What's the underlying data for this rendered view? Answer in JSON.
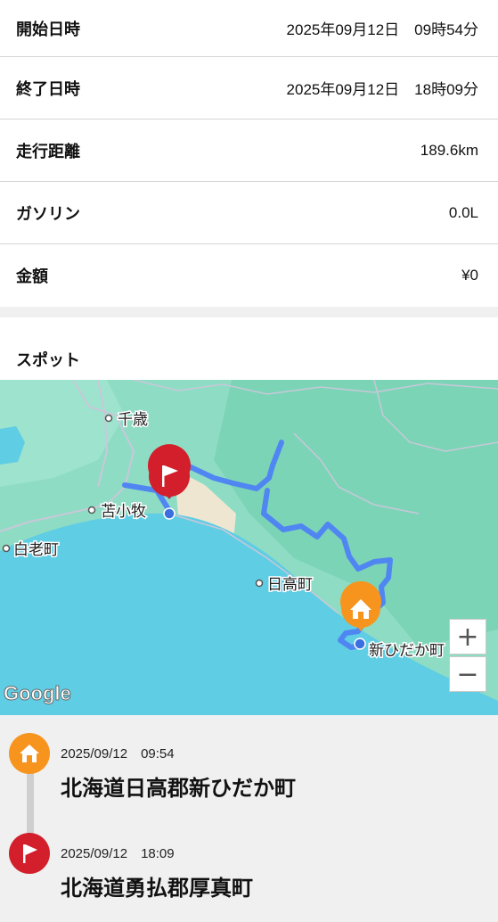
{
  "details": [
    {
      "label": "開始日時",
      "value": "2025年09月12日　09時54分"
    },
    {
      "label": "終了日時",
      "value": "2025年09月12日　18時09分"
    },
    {
      "label": "走行距離",
      "value": "189.6km"
    },
    {
      "label": "ガソリン",
      "value": "0.0L"
    },
    {
      "label": "金額",
      "value": "¥0"
    }
  ],
  "spots": {
    "title": "スポット",
    "map": {
      "labels": {
        "chitose": "千歳",
        "tomakomai": "苫小牧",
        "shiraoi": "白老町",
        "hidaka": "日高町",
        "shinhidaka": "新ひだか町"
      },
      "logo": "Google",
      "zoom_in": "+",
      "zoom_out": "−",
      "colors": {
        "route": "#4f86f2",
        "sea": "#5fcde4",
        "land": "#8fdcc4",
        "start": "#f7941d",
        "end": "#d21f2b"
      }
    },
    "timeline": [
      {
        "icon": "home-icon",
        "time": "2025/09/12　09:54",
        "address": "北海道日高郡新ひだか町"
      },
      {
        "icon": "flag-icon",
        "time": "2025/09/12　18:09",
        "address": "北海道勇払郡厚真町"
      }
    ]
  }
}
